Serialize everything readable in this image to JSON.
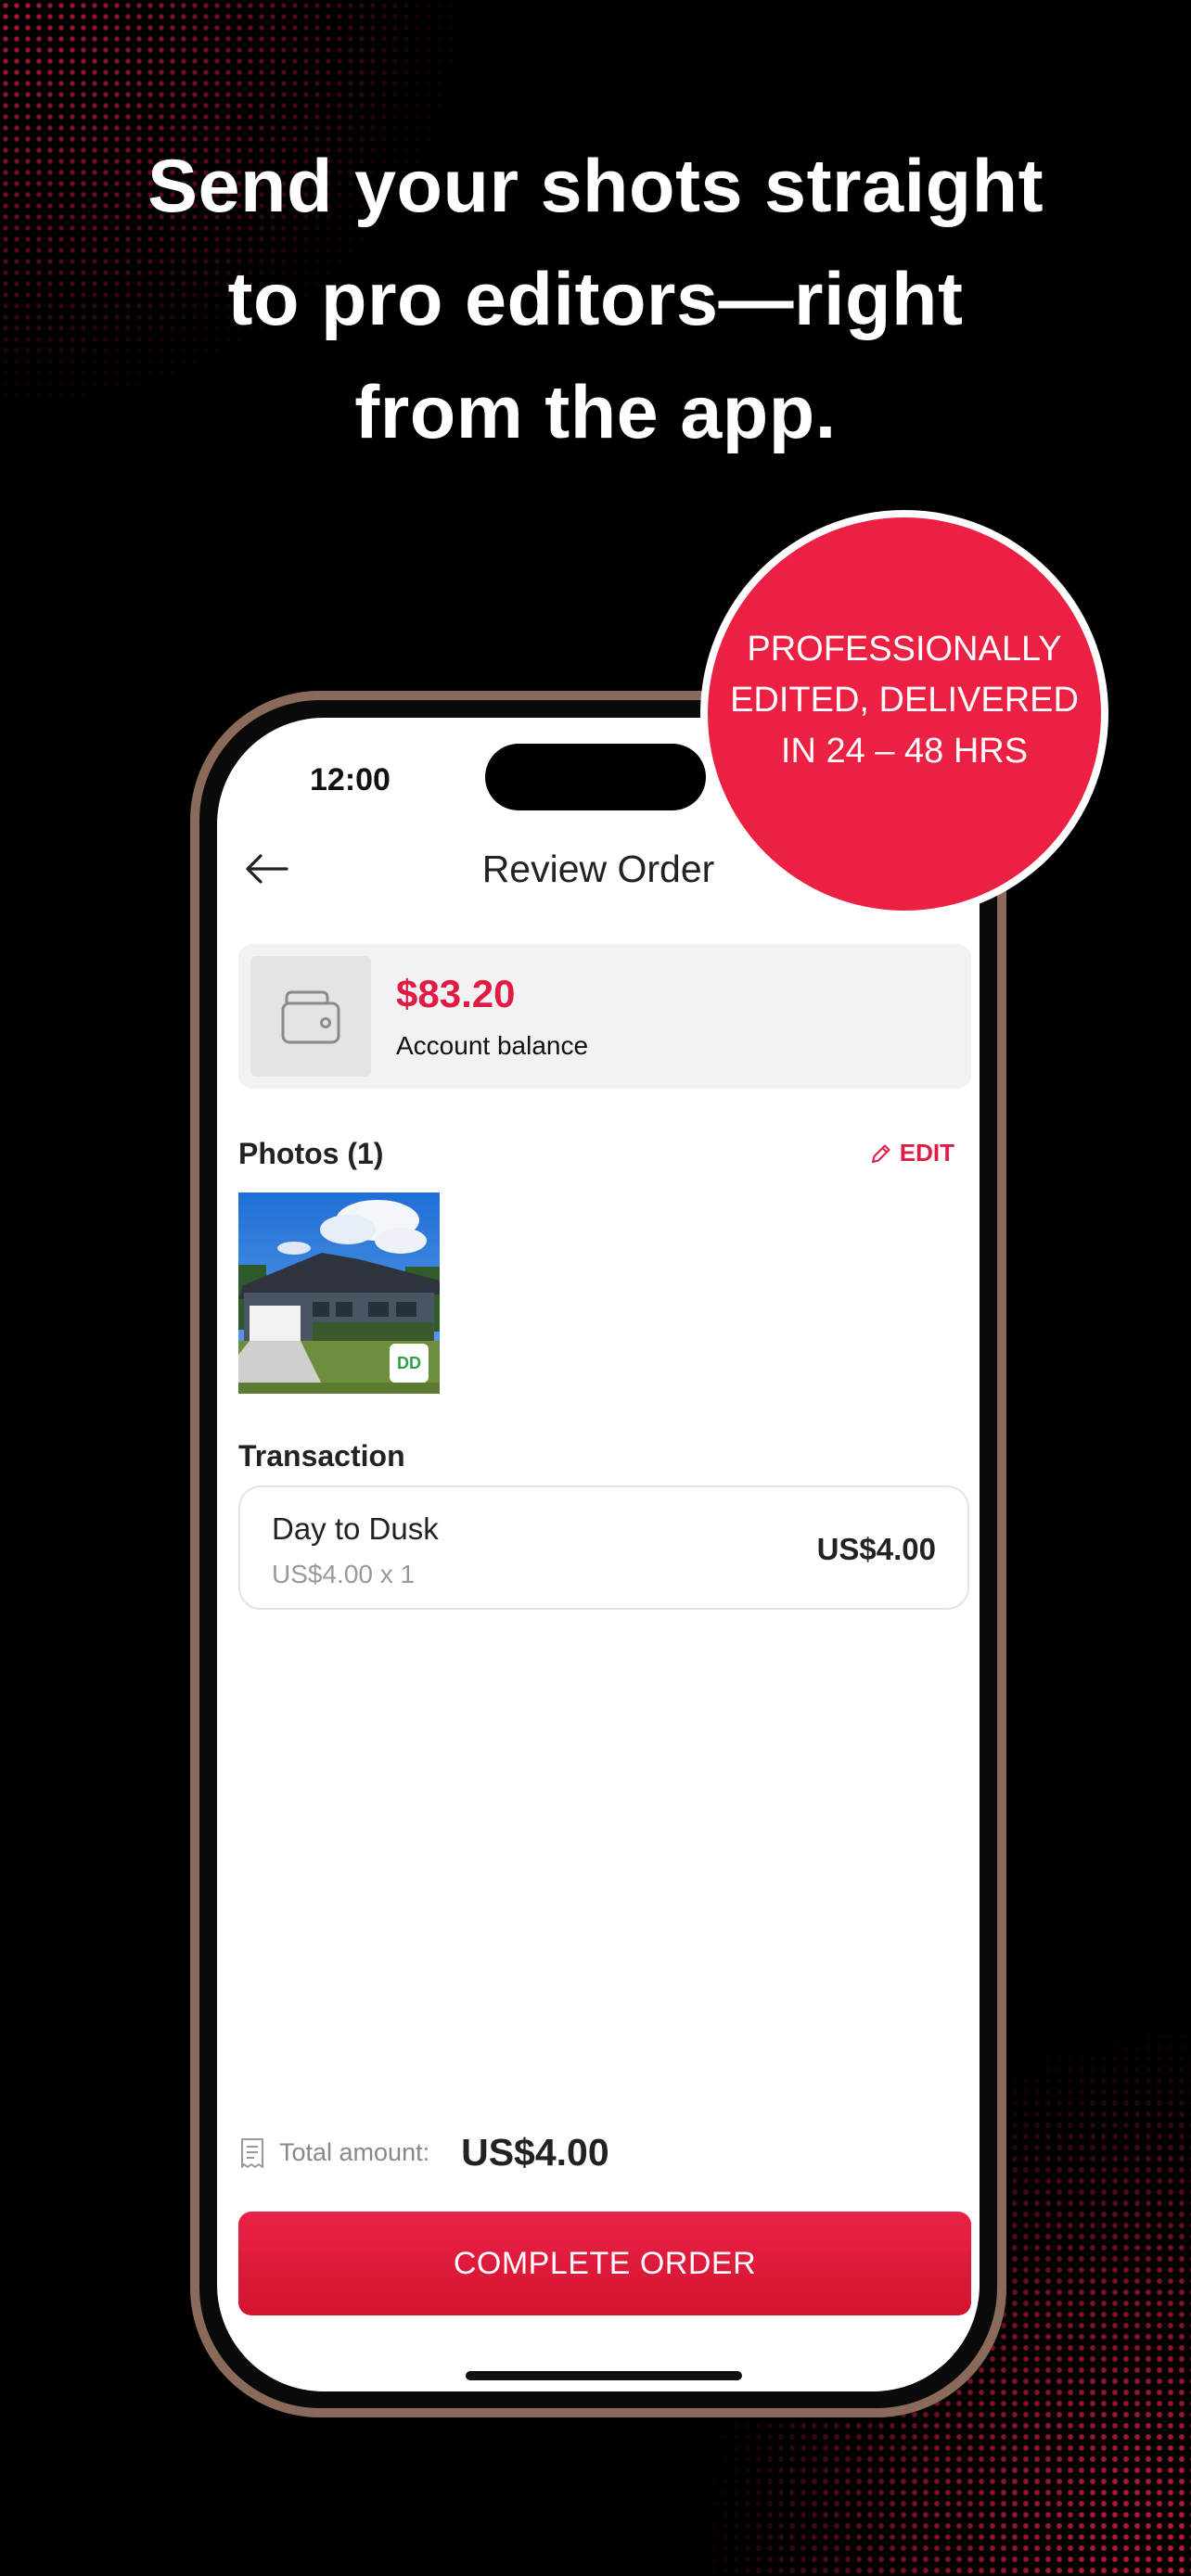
{
  "headline": {
    "line1": "Send your shots straight",
    "line2": "to pro editors—right",
    "line3": "from the app."
  },
  "badge": {
    "line1": "PROFESSIONALLY",
    "line2": "EDITED, DELIVERED",
    "line3": "IN 24 – 48 HRS"
  },
  "status_bar": {
    "time": "12:00"
  },
  "nav": {
    "title": "Review Order",
    "back_icon": "arrow-left-icon"
  },
  "balance": {
    "amount": "$83.20",
    "label": "Account balance",
    "icon": "wallet-icon"
  },
  "photos": {
    "heading": "Photos (1)",
    "edit_label": "EDIT",
    "items": [
      {
        "badge": "DD"
      }
    ]
  },
  "transaction": {
    "heading": "Transaction",
    "items": [
      {
        "name": "Day to Dusk",
        "detail": "US$4.00 x 1",
        "price": "US$4.00"
      }
    ]
  },
  "total": {
    "label": "Total amount:",
    "value": "US$4.00"
  },
  "cta": {
    "label": "COMPLETE ORDER"
  },
  "colors": {
    "accent": "#e31b44",
    "badge_red": "#eb2043",
    "background": "#000000",
    "phone_frame": "#8a6a5a"
  }
}
